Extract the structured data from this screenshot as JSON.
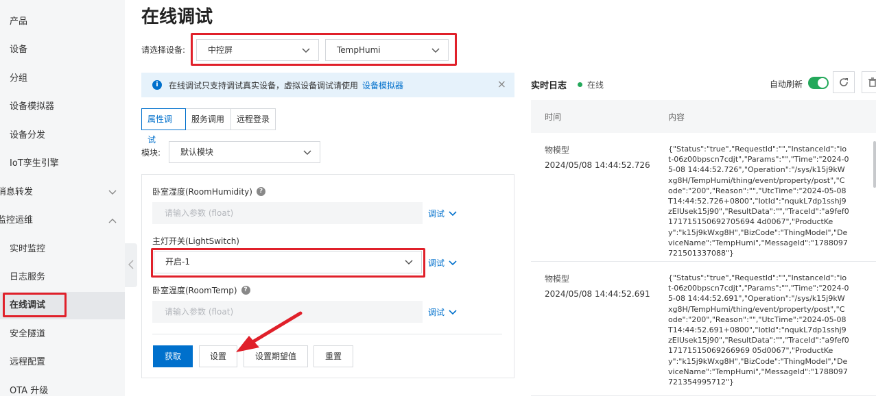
{
  "sidebar": {
    "items": [
      {
        "label": "产品"
      },
      {
        "label": "设备"
      },
      {
        "label": "分组"
      },
      {
        "label": "设备模拟器"
      },
      {
        "label": "设备分发"
      },
      {
        "label": "IoT孪生引擎"
      },
      {
        "label": "消息转发"
      },
      {
        "label": "监控运维"
      },
      {
        "label": "实时监控"
      },
      {
        "label": "日志服务"
      },
      {
        "label": "在线调试"
      },
      {
        "label": "安全隧道"
      },
      {
        "label": "远程配置"
      },
      {
        "label": "OTA 升级"
      }
    ]
  },
  "page": {
    "title": "在线调试"
  },
  "device_select": {
    "label": "请选择设备:",
    "product": "中控屏",
    "device": "TempHumi"
  },
  "notice": {
    "text": "在线调试只支持调试真实设备，虚拟设备调试请使用",
    "link": "设备模拟器",
    "close": "×"
  },
  "tabs": [
    {
      "label": "属性调试"
    },
    {
      "label": "服务调用"
    },
    {
      "label": "远程登录"
    }
  ],
  "module": {
    "label": "模块:",
    "value": "默认模块"
  },
  "properties": [
    {
      "label": "卧室湿度(RoomHumidity)",
      "placeholder": "请输入参数 (float)",
      "action": "调试"
    },
    {
      "label": "主灯开关(LightSwitch)",
      "value": "开启-1",
      "action": "调试"
    },
    {
      "label": "卧室温度(RoomTemp)",
      "placeholder": "请输入参数 (float)",
      "action": "调试"
    }
  ],
  "buttons": {
    "get": "获取",
    "set": "设置",
    "set_expected": "设置期望值",
    "reset": "重置"
  },
  "log": {
    "title": "实时日志",
    "status": "在线",
    "auto_refresh": "自动刷新",
    "col_time": "时间",
    "col_content": "内容",
    "rows": [
      {
        "type": "物模型",
        "time": "2024/05/08 14:44:52.726",
        "content": "{\"Status\":\"true\",\"RequestId\":\"\",\"InstanceId\":\"iot-06z00bpscn7cdjt\",\"Params\":\"\",\"Time\":\"2024-05-08 14:44:52.726\",\"Operation\":\"/sys/k15j9kWxg8H/TempHumi/thing/event/property/post\",\"Code\":\"200\",\"Reason\":\"\",\"UtcTime\":\"2024-05-08T14:44:52.726+0800\",\"IotId\":\"nqukL7dp1sshj9zEIUsek15j90\",\"ResultData\":\"\",\"TraceId\":\"a9fef0171715150692705694 4d0067\",\"ProductKey\":\"k15j9kWxg8H\",\"BizCode\":\"ThingModel\",\"DeviceName\":\"TempHumi\",\"MessageId\":\"1788097721501337088\"}"
      },
      {
        "type": "物模型",
        "time": "2024/05/08 14:44:52.691",
        "content": "{\"Status\":\"true\",\"RequestId\":\"\",\"InstanceId\":\"iot-06z00bpscn7cdjt\",\"Params\":\"\",\"Time\":\"2024-05-08 14:44:52.691\",\"Operation\":\"/sys/k15j9kWxg8H/TempHumi/thing/event/property/post\",\"Code\":\"200\",\"Reason\":\"\",\"UtcTime\":\"2024-05-08T14:44:52.691+0800\",\"IotId\":\"nqukL7dp1sshj9zEIUsek15j90\",\"ResultData\":\"\",\"TraceId\":\"a9fef017171515069266969 05d0067\",\"ProductKey\":\"k15j9kWxg8H\",\"BizCode\":\"ThingModel\",\"DeviceName\":\"TempHumi\",\"MessageId\":\"1788097721354995712\"}"
      }
    ]
  },
  "colors": {
    "accent": "#0070cc",
    "highlight": "#e0202a",
    "online": "#23a85a"
  }
}
